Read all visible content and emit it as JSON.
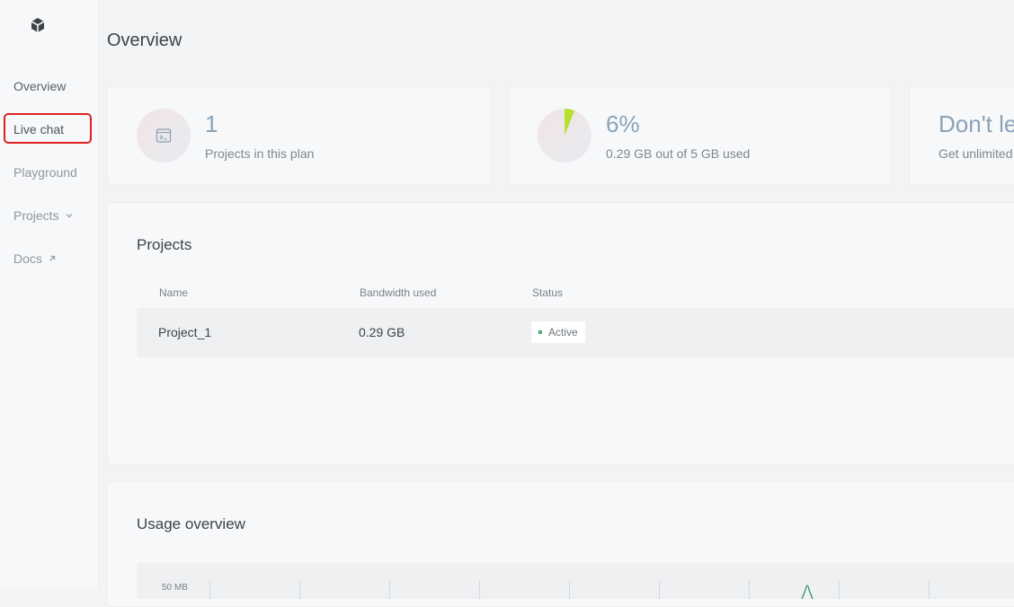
{
  "sidebar": {
    "logo_icon": "cube-icon",
    "items": [
      {
        "label": "Overview"
      },
      {
        "label": "Live chat"
      },
      {
        "label": "Playground"
      },
      {
        "label": "Projects",
        "icon": "chevron-down-icon"
      },
      {
        "label": "Docs",
        "icon": "external-link-icon"
      }
    ]
  },
  "page": {
    "title": "Overview"
  },
  "stats": [
    {
      "value": "1",
      "label": "Projects in this plan",
      "icon": "terminal-icon"
    },
    {
      "value": "6%",
      "label": "0.29 GB out of 5 GB used",
      "icon": "pie-chart-icon",
      "fraction_used": 0.06
    },
    {
      "value": "Don't le",
      "label": "Get unlimited"
    }
  ],
  "projects": {
    "title": "Projects",
    "columns": [
      "Name",
      "Bandwidth used",
      "Status"
    ],
    "rows": [
      {
        "name": "Project_1",
        "bandwidth": "0.29 GB",
        "status": "Active"
      }
    ]
  },
  "usage": {
    "title": "Usage overview",
    "y_label": "50 MB"
  },
  "colors": {
    "accent_green": "#b5e02c",
    "status_green": "#4caf78",
    "highlight_red": "#e02020"
  }
}
